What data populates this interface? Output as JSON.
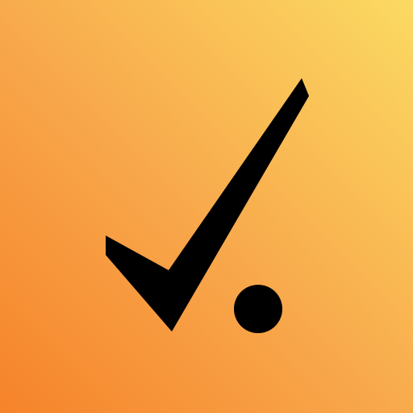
{
  "app_icon": {
    "icon_name": "checkmark-dot-icon",
    "background_gradient": [
      "#F6832A",
      "#F8A64A",
      "#FBDA62"
    ],
    "glyph_color": "#000000"
  }
}
